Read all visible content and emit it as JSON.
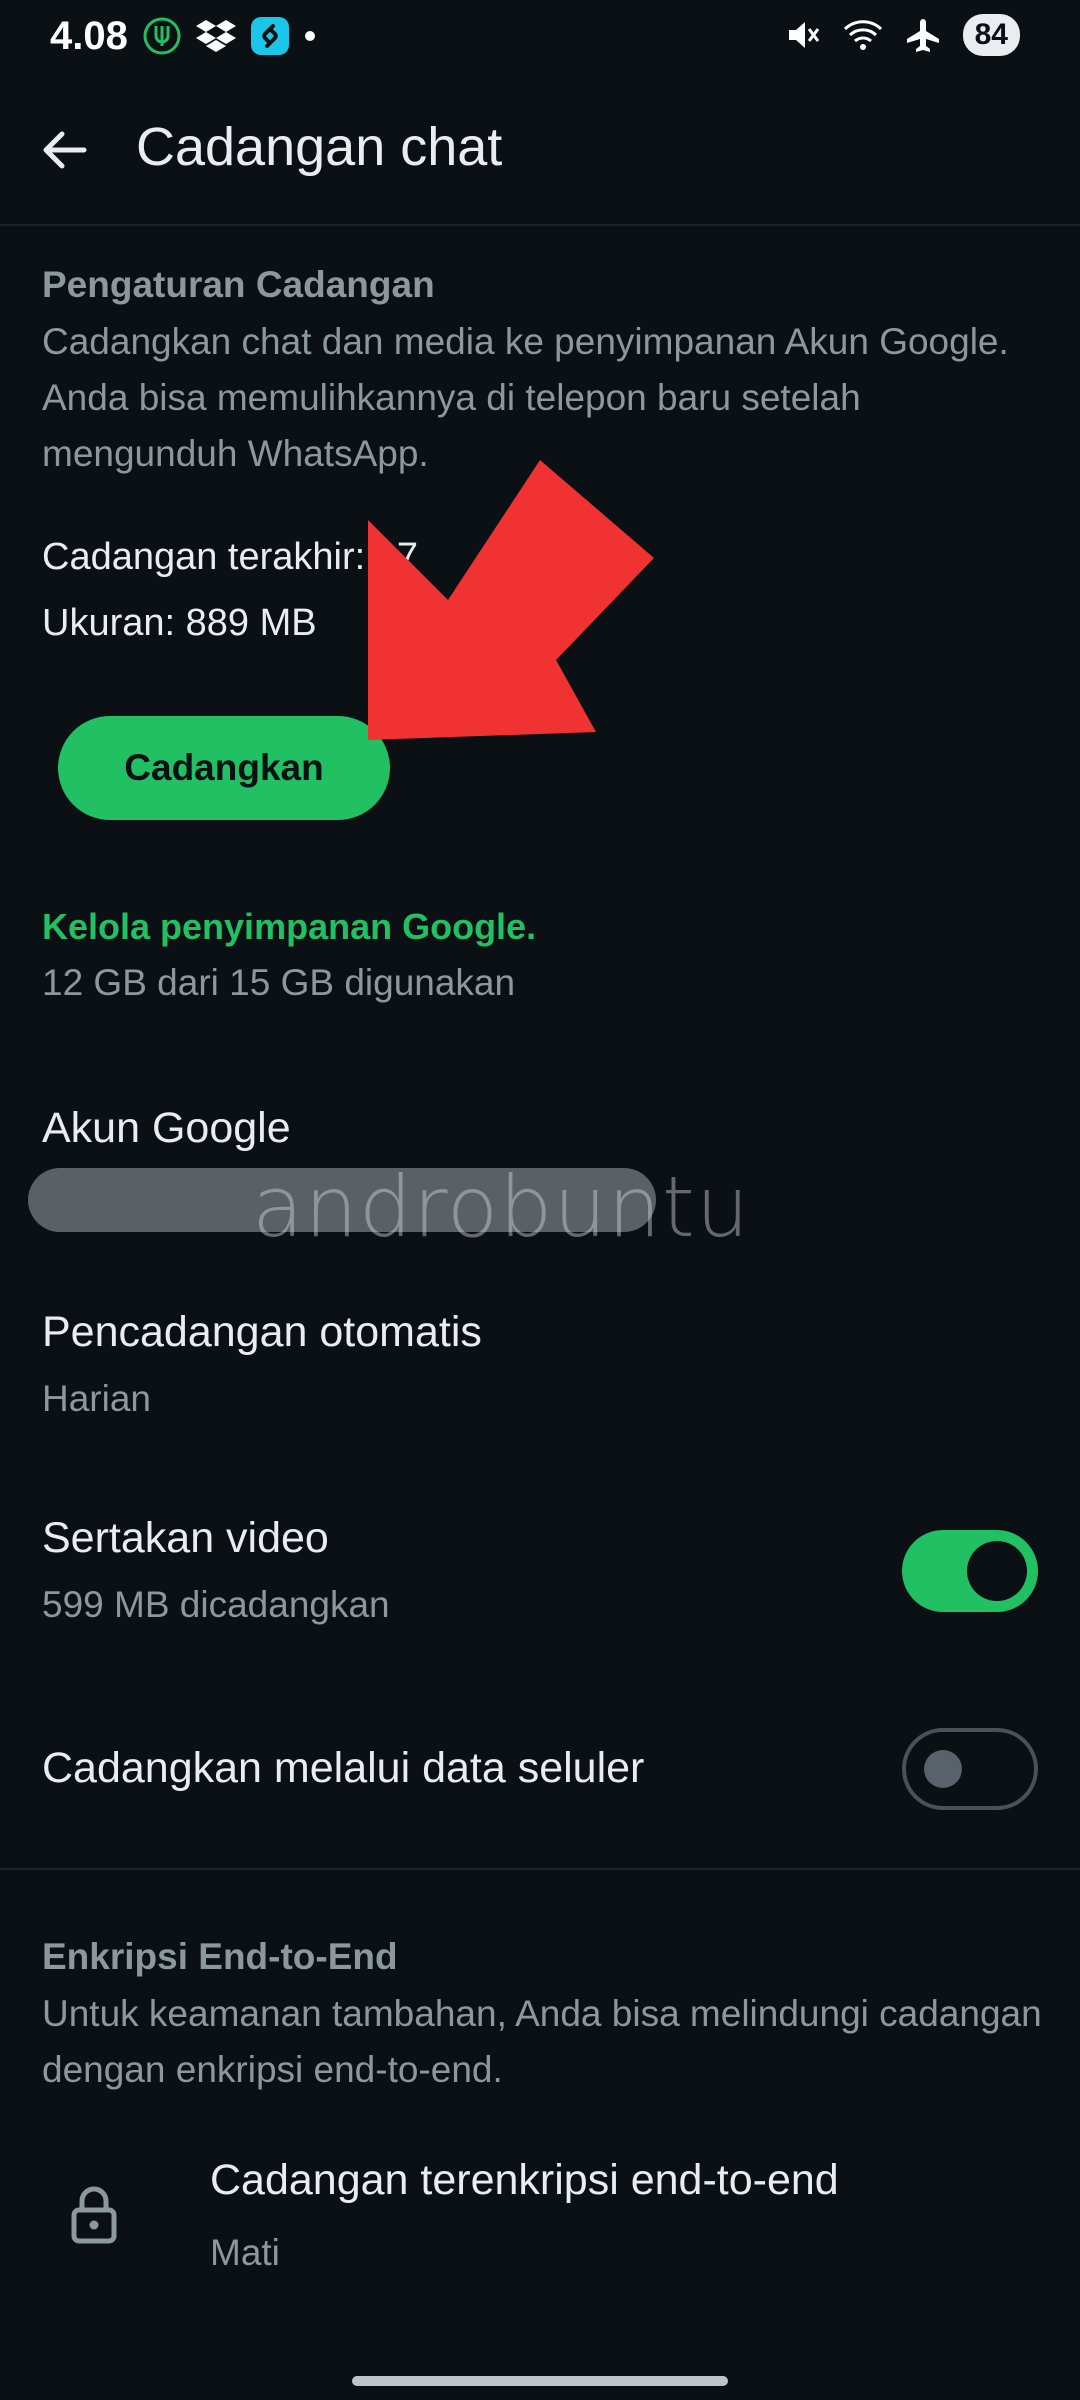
{
  "status_bar": {
    "time": "4.08",
    "battery": "84",
    "left_icons": [
      "app-notification-icon",
      "dropbox-icon",
      "shazam-icon",
      "dot-icon"
    ],
    "right_icons": [
      "mute-icon",
      "wifi-icon",
      "airplane-icon",
      "battery-icon"
    ]
  },
  "header": {
    "title": "Cadangan chat",
    "back_icon": "back-arrow-icon"
  },
  "backup_settings": {
    "heading": "Pengaturan Cadangan",
    "description": "Cadangkan chat dan media ke penyimpanan Akun Google. Anda bisa memulihkannya di telepon baru setelah mengunduh WhatsApp.",
    "last_backup": "Cadangan terakhir: 07",
    "size": "Ukuran: 889 MB",
    "button_label": "Cadangkan"
  },
  "storage": {
    "link": "Kelola penyimpanan Google.",
    "usage": "12 GB dari 15 GB digunakan"
  },
  "google_account": {
    "title": "Akun Google",
    "watermark": "androbuntu"
  },
  "auto_backup": {
    "title": "Pencadangan otomatis",
    "value": "Harian"
  },
  "include_video": {
    "title": "Sertakan video",
    "subtitle": "599 MB dicadangkan",
    "enabled": true
  },
  "cellular": {
    "title": "Cadangkan melalui data seluler",
    "enabled": false
  },
  "encryption": {
    "heading": "Enkripsi End-to-End",
    "description": "Untuk keamanan tambahan, Anda bisa melindungi cadangan dengan enkripsi end-to-end.",
    "item_title": "Cadangan terenkripsi end-to-end",
    "item_value": "Mati",
    "icon": "lock-icon"
  },
  "colors": {
    "background": "#0b1014",
    "accent": "#21c063",
    "annotation_arrow": "#f03232"
  }
}
